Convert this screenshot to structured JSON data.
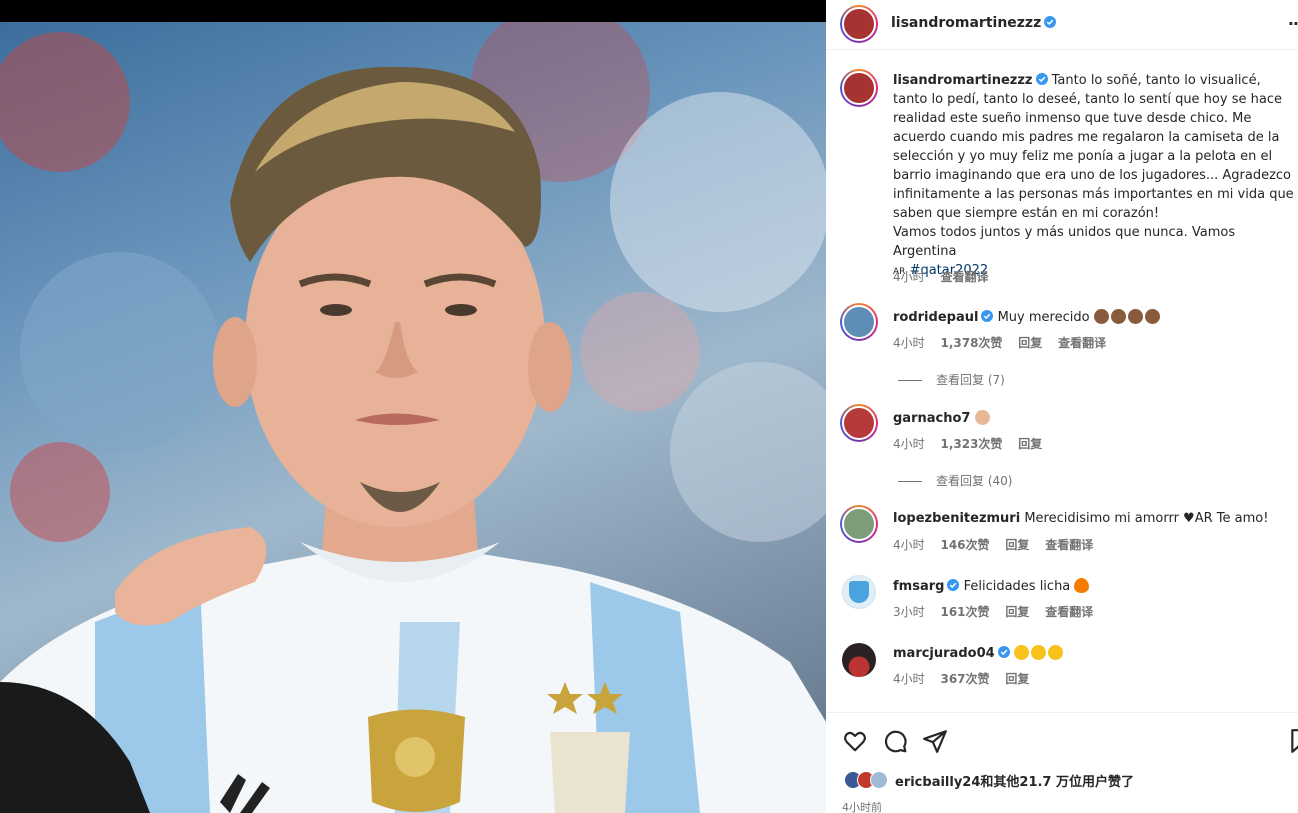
{
  "post": {
    "author": "lisandromartinezzz",
    "caption_user": "lisandromartinezzz",
    "caption_text": "Tanto lo soñé, tanto lo visualicé, tanto lo pedí, tanto lo deseé, tanto lo sentí que hoy se hace realidad este sueño inmenso que tuve desde chico. Me acuerdo cuando mis padres me regalaron la camiseta de la selección y yo muy feliz me ponía a jugar a la pelota en el barrio imaginando que era uno de los jugadores... Agradezco infinitamente a las personas más importantes en mi vida que saben que siempre están en mi corazón!",
    "caption_line2": "Vamos todos juntos y más unidos que nunca. Vamos Argentina",
    "flag_text": "AR",
    "hashtag": "#qatar2022",
    "time": "4小时",
    "translate": "查看翻译"
  },
  "comments": [
    {
      "user": "rodridepaul",
      "verified": true,
      "text": "Muy merecido",
      "emoji_count": 4,
      "emoji_color": "#8a5a3c",
      "time": "4小时",
      "likes": "1,378次赞",
      "reply": "回复",
      "translate": "查看翻译",
      "view_replies": "查看回复 (7)"
    },
    {
      "user": "garnacho7",
      "verified": false,
      "text": "",
      "emoji_count": 1,
      "emoji_color": "#e8b896",
      "time": "4小时",
      "likes": "1,323次赞",
      "reply": "回复",
      "translate": "",
      "view_replies": "查看回复 (40)"
    },
    {
      "user": "lopezbenitezmuri",
      "verified": false,
      "text": "Merecidisimo mi amorrr ♥AR Te amo!",
      "emoji_count": 0,
      "emoji_color": "",
      "time": "4小时",
      "likes": "146次赞",
      "reply": "回复",
      "translate": "查看翻译",
      "view_replies": ""
    },
    {
      "user": "fmsarg",
      "verified": true,
      "text": "Felicidades licha",
      "emoji_count": 1,
      "emoji_color": "#f57c00",
      "time": "3小时",
      "likes": "161次赞",
      "reply": "回复",
      "translate": "查看翻译",
      "view_replies": ""
    },
    {
      "user": "marcjurado04",
      "verified": true,
      "text": "",
      "emoji_count": 3,
      "emoji_color": "#f7c21b",
      "time": "4小时",
      "likes": "367次赞",
      "reply": "回复",
      "translate": "",
      "view_replies": ""
    }
  ],
  "likes_text": {
    "user": "ericbailly24",
    "rest": "和其他21.7 万位用户赞了"
  },
  "footer_time": "4小时前",
  "colors": {
    "verified": "#3897f0",
    "hashtag": "#00376b",
    "muted": "#737373",
    "jersey_blue": "#8cc0e6"
  },
  "icons": [
    "heart-icon",
    "comment-icon",
    "share-icon",
    "save-icon",
    "verified-icon",
    "more-icon"
  ]
}
